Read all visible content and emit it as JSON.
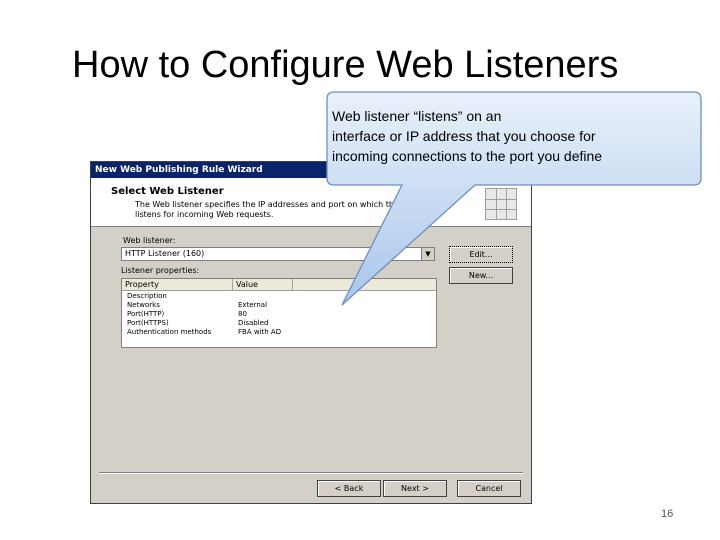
{
  "slide": {
    "title": "How to Configure Web Listeners",
    "page_number": "16"
  },
  "callout": {
    "line1": "Web listener “listens” on an",
    "line2": "interface or IP address that you choose for",
    "line3": "incoming connections to the port you define"
  },
  "dialog": {
    "title": "New Web Publishing Rule Wizard",
    "header_title": "Select Web Listener",
    "header_desc": "The Web listener specifies the IP addresses and port on which this computer listens for incoming Web requests.",
    "web_listener_label": "Web listener:",
    "web_listener_value": "HTTP Listener (160)",
    "edit_button": "Edit...",
    "new_button": "New...",
    "properties_label": "Listener properties:",
    "columns": [
      "Property",
      "Value"
    ],
    "rows": [
      {
        "property": "Description",
        "value": ""
      },
      {
        "property": "Networks",
        "value": "External"
      },
      {
        "property": "Port(HTTP)",
        "value": "80"
      },
      {
        "property": "Port(HTTPS)",
        "value": "Disabled"
      },
      {
        "property": "Authentication methods",
        "value": "FBA with AD"
      }
    ],
    "back_button": "< Back",
    "next_button": "Next >",
    "cancel_button": "Cancel"
  }
}
